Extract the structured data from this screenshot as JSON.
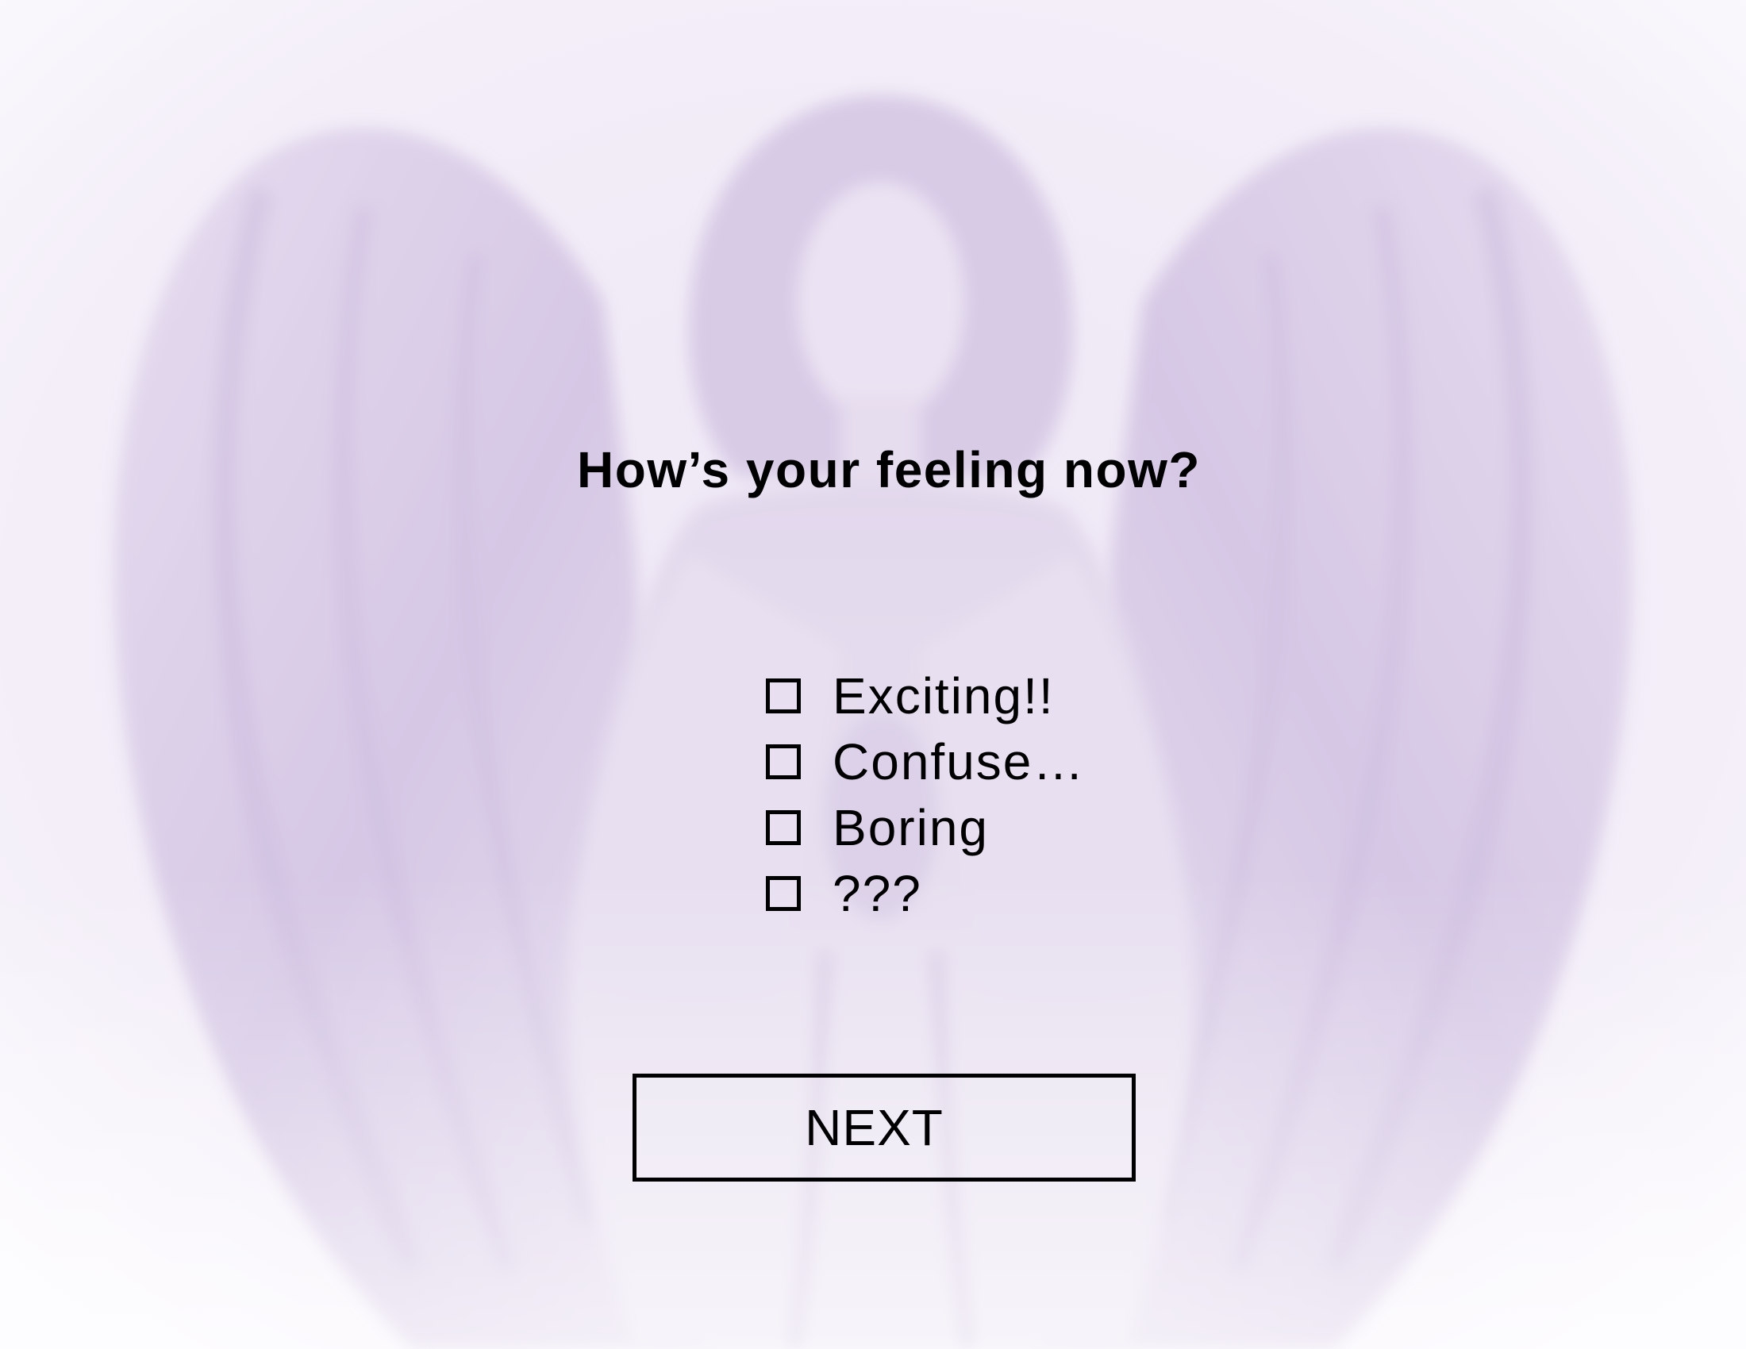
{
  "question": "How’s your feeling now?",
  "options": [
    {
      "label": "Exciting!!",
      "checked": false
    },
    {
      "label": "Confuse…",
      "checked": false
    },
    {
      "label": "Boring",
      "checked": false
    },
    {
      "label": "???",
      "checked": false
    }
  ],
  "next_button": {
    "label": "NEXT"
  },
  "colors": {
    "background": "#f4f0f8",
    "wing": "#d9cce6",
    "statue": "#e4dbee",
    "text": "#000000"
  }
}
